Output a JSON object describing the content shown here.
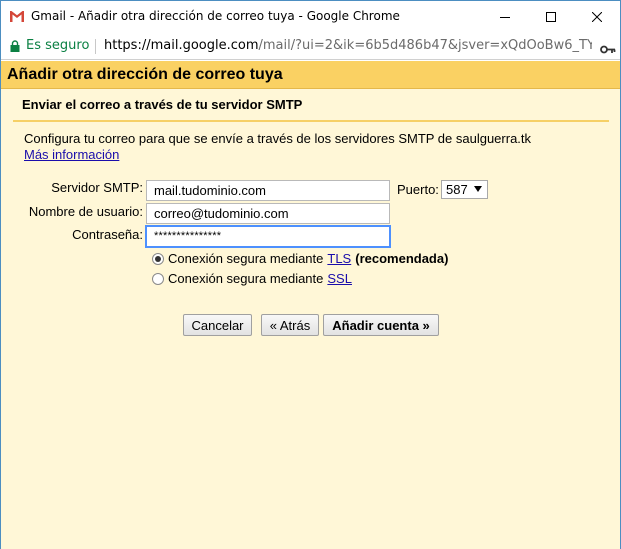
{
  "window": {
    "title": "Gmail - Añadir otra dirección de correo tuya - Google Chrome",
    "controls": {
      "minimize": "—",
      "maximize": "☐",
      "close": "✕"
    }
  },
  "addressbar": {
    "secure_label": "Es seguro",
    "url_host": "https://mail.google.com",
    "url_path": "/mail/?ui=2&ik=6b5d486b47&jsver=xQdOoBw6_TY...."
  },
  "dialog": {
    "title": "Añadir otra dirección de correo tuya",
    "section_title": "Enviar el correo a través de tu servidor SMTP",
    "description": "Configura tu correo para que se envíe a través de los servidores SMTP de saulguerra.tk",
    "more_info_link": "Más información",
    "form": {
      "smtp_server_label": "Servidor SMTP:",
      "smtp_server_value": "mail.tudominio.com",
      "port_label": "Puerto:",
      "port_value": "587",
      "username_label": "Nombre de usuario:",
      "username_value": "correo@tudominio.com",
      "password_label": "Contraseña:",
      "password_value": "***************"
    },
    "security": {
      "tls_prefix": "Conexión segura mediante",
      "tls_link": "TLS",
      "tls_suffix": "(recomendada)",
      "ssl_prefix": "Conexión segura mediante",
      "ssl_link": "SSL",
      "selected": "TLS"
    },
    "buttons": {
      "cancel": "Cancelar",
      "back": "« Atrás",
      "add": "Añadir cuenta »"
    }
  },
  "colors": {
    "header_bg": "#fad163",
    "body_bg": "#fff7d7",
    "secure_green": "#0b8043",
    "link_blue": "#1a0dab"
  }
}
